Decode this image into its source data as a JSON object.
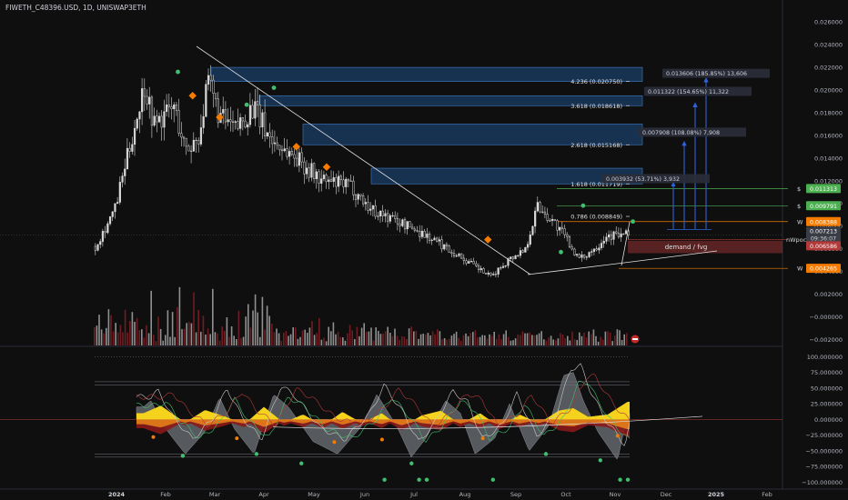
{
  "header": {
    "symbol_title": "FIWETH_C48396.USD, 1D, UNISWAP3ETH"
  },
  "colors": {
    "background": "#0f0f0f",
    "candle": "#d9d9d9",
    "volume_down": "#7a1f25",
    "volume_up": "#9e9e9e",
    "fib_zone": "#1f4f86",
    "green_line": "#4caf50",
    "red_line": "#b23a3a",
    "orange": "#f57c00",
    "arrow_blue": "#2f62d8",
    "osc_yellow": "#f5d31c",
    "osc_orange": "#e07a1a",
    "osc_red": "#8b1a1a",
    "osc_gray": "#6f7378",
    "marker_green": "#3fbf6f"
  },
  "chart_data": [
    {
      "type": "candlestick",
      "title": "",
      "xlabel": "",
      "ylabel": "",
      "x_tick_labels": [
        "2024",
        "Feb",
        "Mar",
        "Apr",
        "May",
        "Jun",
        "Jul",
        "Aug",
        "Sep",
        "Oct",
        "Nov",
        "Dec",
        "2025",
        "Feb"
      ],
      "y_tick_labels": [
        "0.026000",
        "0.024000",
        "0.022000",
        "0.020000",
        "0.018000",
        "0.016000",
        "0.014000",
        "0.012000",
        "0.010000",
        "0.008000",
        "0.006000",
        "0.004000",
        "0.002000",
        "−0.000000",
        "−0.002000"
      ],
      "y_ticks": [
        0.026,
        0.024,
        0.022,
        0.02,
        0.018,
        0.016,
        0.014,
        0.012,
        0.01,
        0.008,
        0.006,
        0.004,
        0.002,
        0.0,
        -0.002
      ],
      "ylim": [
        -0.0027,
        0.0265
      ],
      "grid": false,
      "price_path": {
        "months": [
          0,
          0.4,
          1.0,
          1.2,
          1.6,
          1.85,
          2.1,
          2.3,
          2.55,
          2.85,
          3.2,
          3.6,
          4.1,
          4.6,
          5.2,
          5.6,
          6.1,
          6.6,
          7.1,
          7.6,
          8.05,
          8.4,
          8.75,
          9.0,
          9.3,
          9.6,
          9.85,
          10.2,
          10.4
        ],
        "close": [
          0.0062,
          0.0095,
          0.0205,
          0.017,
          0.0185,
          0.0145,
          0.016,
          0.0205,
          0.0175,
          0.0165,
          0.0185,
          0.0155,
          0.014,
          0.012,
          0.0115,
          0.0095,
          0.0085,
          0.0075,
          0.0062,
          0.0048,
          0.0035,
          0.005,
          0.006,
          0.0098,
          0.0085,
          0.0068,
          0.005,
          0.0062,
          0.0072
        ]
      },
      "fib_levels": [
        {
          "label": "4.236 (0.020750)",
          "value": 0.02075
        },
        {
          "label": "3.618 (0.018618)",
          "value": 0.018618
        },
        {
          "label": "2.618 (0.015168)",
          "value": 0.015168
        },
        {
          "label": "1.618 (0.011719)",
          "value": 0.011719
        },
        {
          "label": "0.786 (0.008849)",
          "value": 0.008849
        }
      ],
      "target_labels": [
        {
          "text": "0.013606 (185.85%) 13,606",
          "value": 0.0214
        },
        {
          "text": "0.011322 (154.65%) 11,322",
          "value": 0.0198
        },
        {
          "text": "0.007908 (108.08%) 7,908",
          "value": 0.0162
        },
        {
          "text": "0.003932 (53.71%) 3,932",
          "value": 0.0121
        }
      ],
      "price_lines": [
        {
          "label": "$",
          "value": 0.01131,
          "price_tag": "0.011313",
          "color": "#4caf50"
        },
        {
          "label": "$",
          "value": 0.009791,
          "price_tag": "0.009791",
          "color": "#4caf50"
        },
        {
          "label": "W",
          "value": 0.008388,
          "price_tag": "0.008388",
          "color": "#f57c00"
        },
        {
          "label": "nWpoc",
          "value": 0.00681,
          "price_tag": "",
          "color": "#b23a3a"
        },
        {
          "label": "W",
          "value": 0.004265,
          "price_tag": "0.004265",
          "color": "#f57c00"
        }
      ],
      "last_price": {
        "price": "0.007213",
        "countdown": "09:36:07",
        "value": 0.0072
      },
      "extra_tag": {
        "text": "0.006586",
        "value": 0.00625
      },
      "demand_zone": {
        "label": "demand / fvg",
        "top": 0.0067,
        "bottom": 0.0056
      },
      "orange_markers": [
        {
          "month": 1.55,
          "value": 0.0195
        },
        {
          "month": 2.1,
          "value": 0.0176
        },
        {
          "month": 3.65,
          "value": 0.015
        },
        {
          "month": 4.25,
          "value": 0.0132
        },
        {
          "month": 7.45,
          "value": 0.0068
        }
      ],
      "green_markers": [
        {
          "month": 1.25,
          "value": 0.0216
        },
        {
          "month": 2.65,
          "value": 0.0187
        },
        {
          "month": 3.2,
          "value": 0.0202
        },
        {
          "month": 8.9,
          "value": 0.0057
        },
        {
          "month": 9.35,
          "value": 0.0098
        },
        {
          "month": 10.35,
          "value": 0.0084
        }
      ]
    },
    {
      "type": "area",
      "title": "",
      "xlabel": "",
      "ylabel": "",
      "y_tick_labels": [
        "100.000000",
        "75.000000",
        "50.000000",
        "25.000000",
        "0.000000",
        "−25.000000",
        "−50.000000",
        "−75.000000",
        "−100.000000"
      ],
      "y_ticks": [
        100,
        75,
        50,
        25,
        0,
        -25,
        -50,
        -75,
        -100
      ],
      "ylim": [
        -108,
        112
      ],
      "grid": false,
      "reference_levels": [
        100,
        60,
        55,
        -55,
        -60
      ],
      "gray_wave": {
        "months": [
          0.55,
          0.7,
          1.0,
          1.4,
          1.8,
          2.1,
          2.4,
          2.8,
          3.2,
          3.5,
          4.0,
          4.5,
          5.0,
          5.3,
          5.7,
          6.0,
          6.3,
          6.7,
          7.0,
          7.3,
          7.7,
          8.0,
          8.4,
          8.8,
          9.1,
          9.3,
          9.5,
          9.8,
          10.2,
          10.4
        ],
        "values": [
          20,
          30,
          -15,
          -55,
          -20,
          35,
          -15,
          -55,
          40,
          20,
          -35,
          -55,
          -10,
          40,
          -10,
          -60,
          -30,
          30,
          10,
          -55,
          -30,
          25,
          -50,
          -10,
          70,
          75,
          30,
          -20,
          -65,
          10
        ]
      },
      "yellow_wave": {
        "months": [
          0.55,
          0.9,
          1.4,
          1.8,
          2.2,
          2.6,
          3.0,
          3.4,
          3.8,
          4.2,
          4.6,
          5.0,
          5.4,
          5.8,
          6.2,
          6.6,
          7.0,
          7.4,
          7.8,
          8.2,
          8.6,
          9.0,
          9.3,
          9.6,
          10.0,
          10.4
        ],
        "values": [
          10,
          22,
          -5,
          15,
          5,
          -8,
          20,
          -5,
          8,
          -10,
          12,
          -6,
          10,
          -14,
          6,
          14,
          -8,
          10,
          -12,
          8,
          -6,
          14,
          18,
          4,
          8,
          28
        ]
      },
      "orange_markers": [
        {
          "month": 0.75,
          "value": -28
        },
        {
          "month": 2.45,
          "value": -30
        },
        {
          "month": 4.4,
          "value": -36
        },
        {
          "month": 5.35,
          "value": -32
        },
        {
          "month": 7.35,
          "value": -30
        },
        {
          "month": 10.05,
          "value": -26
        }
      ],
      "green_markers": [
        {
          "month": 1.35,
          "value": -58
        },
        {
          "month": 2.85,
          "value": -55
        },
        {
          "month": 3.75,
          "value": -70
        },
        {
          "month": 5.4,
          "value": -96
        },
        {
          "month": 5.95,
          "value": -70
        },
        {
          "month": 6.1,
          "value": -96
        },
        {
          "month": 6.25,
          "value": -96
        },
        {
          "month": 7.55,
          "value": -96
        },
        {
          "month": 8.6,
          "value": -55
        },
        {
          "month": 9.7,
          "value": -65
        },
        {
          "month": 10.1,
          "value": -96
        },
        {
          "month": 10.25,
          "value": -96
        }
      ]
    }
  ]
}
